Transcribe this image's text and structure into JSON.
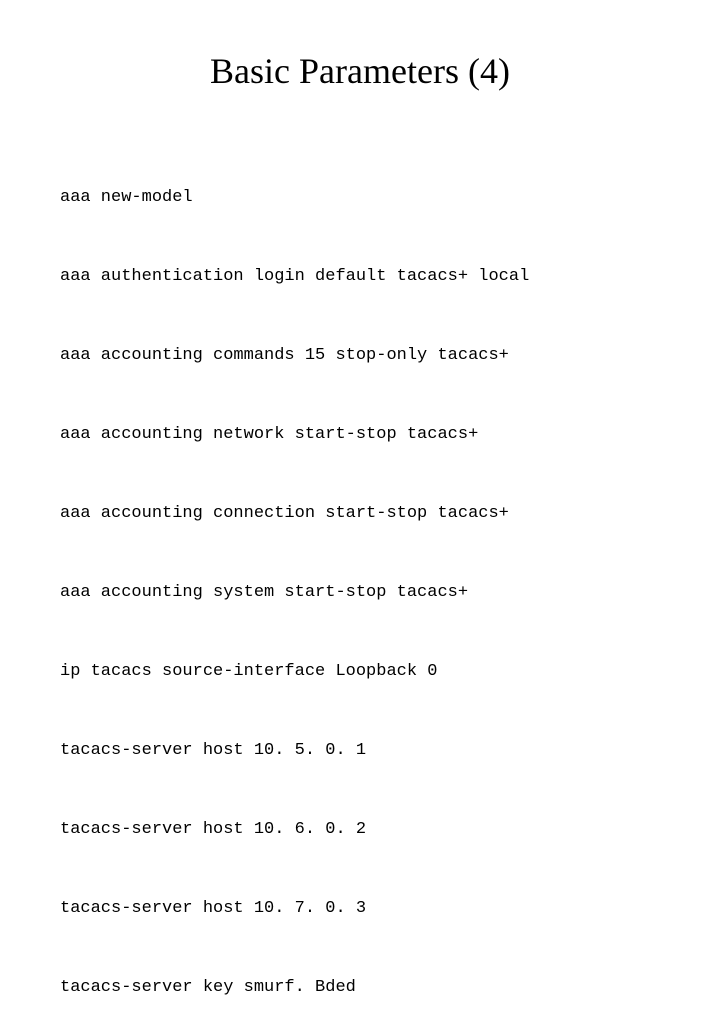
{
  "title": "Basic Parameters (4)",
  "config_lines": [
    "aaa new-model",
    "aaa authentication login default tacacs+ local",
    "aaa accounting commands 15 stop-only tacacs+",
    "aaa accounting network start-stop tacacs+",
    "aaa accounting connection start-stop tacacs+",
    "aaa accounting system start-stop tacacs+",
    "ip tacacs source-interface Loopback 0",
    "tacacs-server host 10. 5. 0. 1",
    "tacacs-server host 10. 6. 0. 2",
    "tacacs-server host 10. 7. 0. 3",
    "tacacs-server key smurf. Bded"
  ]
}
